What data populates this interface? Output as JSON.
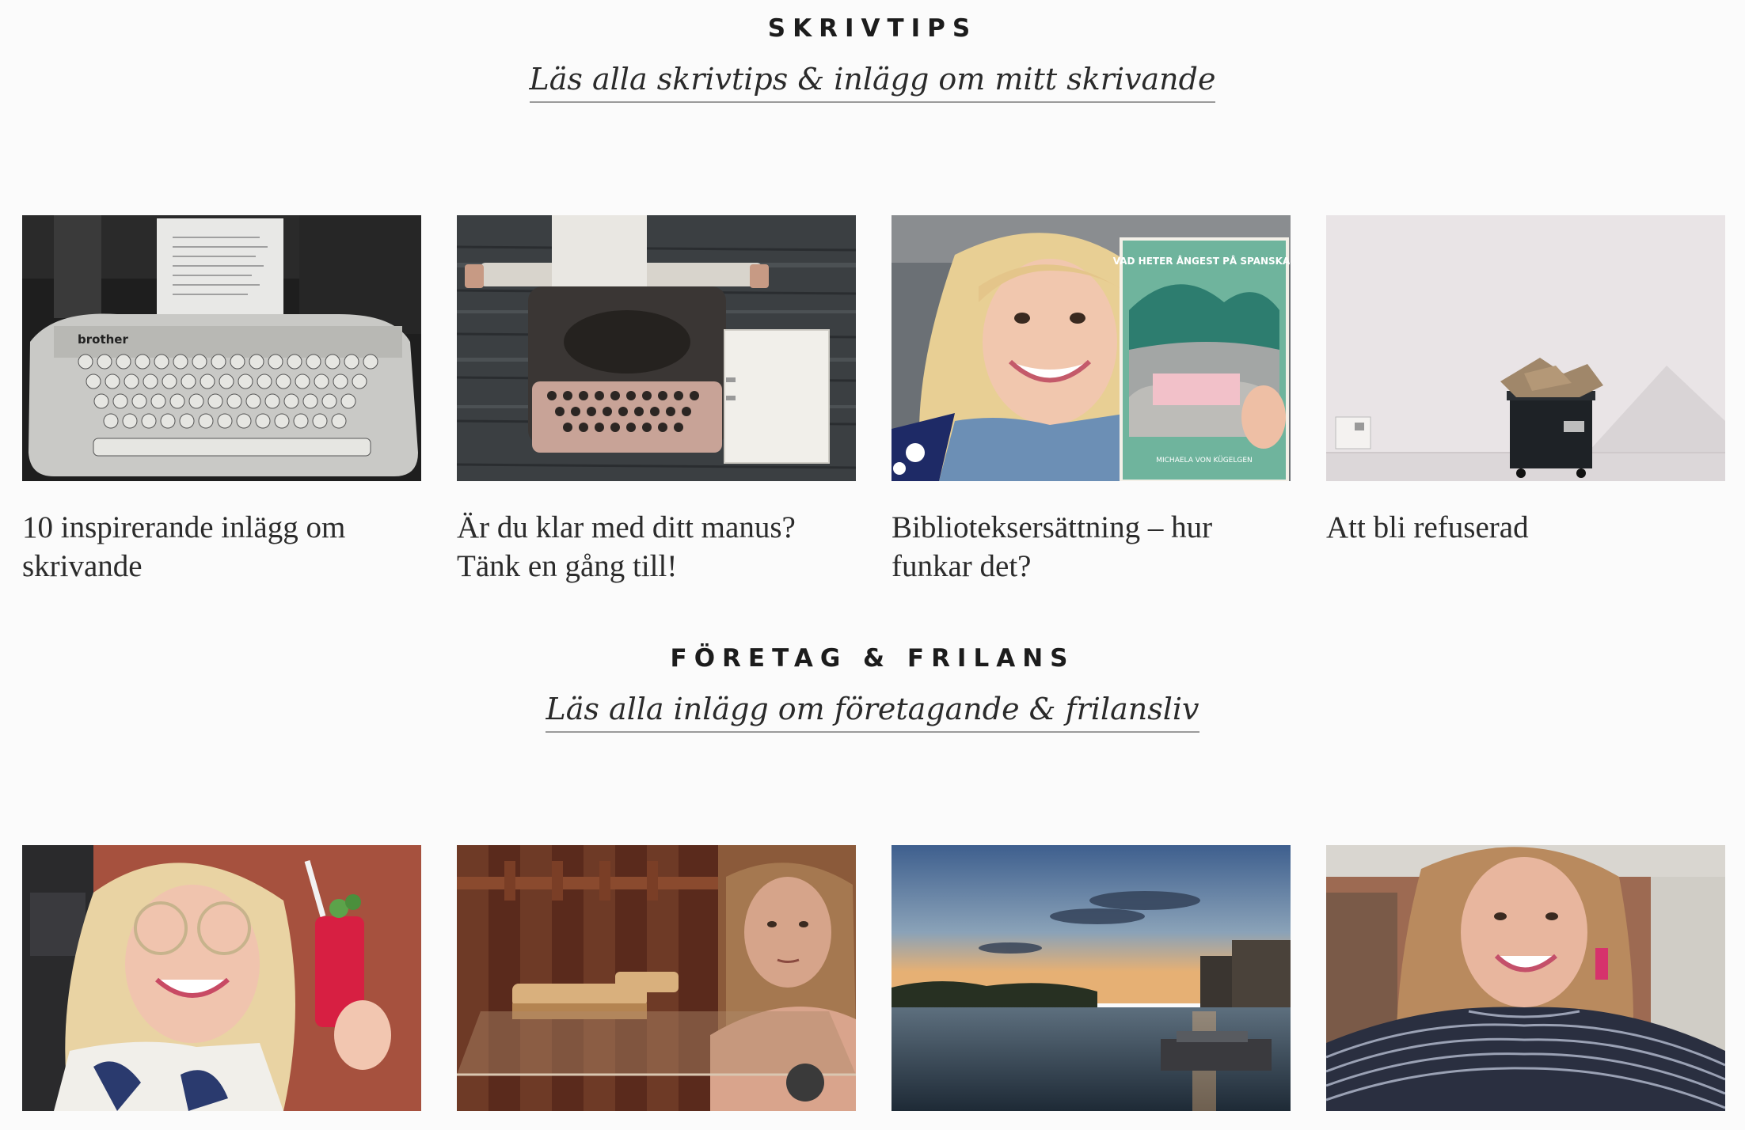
{
  "sections": [
    {
      "title": "SKRIVTIPS",
      "link": "Läs alla skrivtips & inlägg om mitt skrivande",
      "posts": [
        {
          "title": "10 inspirerande inlägg om skrivande",
          "image": "typewriter-bw-photo"
        },
        {
          "title": "Är du klar med ditt manus? Tänk en gång till!",
          "image": "typewriter-wooden-table-photo"
        },
        {
          "title": "Biblioteksersättning – hur funkar det?",
          "image": "woman-with-book-photo"
        },
        {
          "title": "Att bli refuserad",
          "image": "trash-bin-wall-photo"
        }
      ],
      "book_cover_text": {
        "title": "VAD HETER ÅNGEST PÅ SPANSKA?",
        "author": "MICHAELA VON KÜGELGEN"
      },
      "typewriter_brand": "brother"
    },
    {
      "title": "FÖRETAG & FRILANS",
      "link": "Läs alla inlägg om företagande & frilansliv",
      "posts": [
        {
          "title": "",
          "image": "woman-with-drink-photo"
        },
        {
          "title": "",
          "image": "woman-sauna-photo"
        },
        {
          "title": "",
          "image": "river-sunset-photo"
        },
        {
          "title": "",
          "image": "woman-striped-sweater-photo"
        }
      ]
    }
  ]
}
